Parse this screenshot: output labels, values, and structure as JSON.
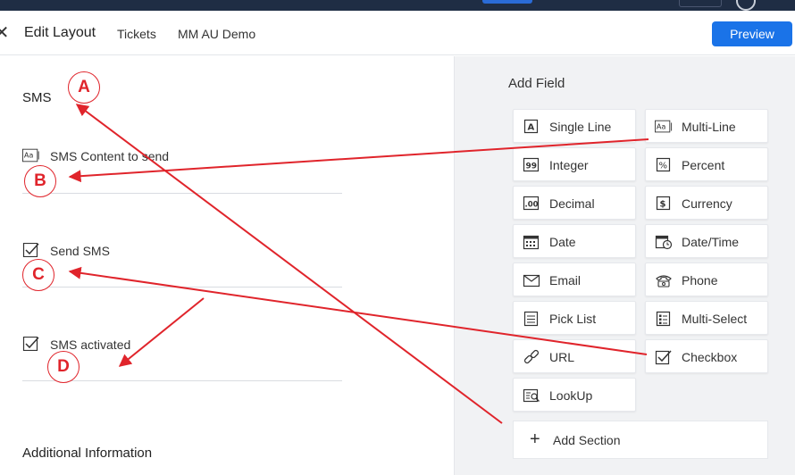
{
  "header": {
    "title": "Edit Layout",
    "breadcrumbs": [
      "Tickets",
      "MM AU Demo"
    ],
    "preview_label": "Preview"
  },
  "layout": {
    "sections": [
      {
        "title": "SMS",
        "fields": [
          {
            "label": "SMS Content to send",
            "icon": "multi-line-icon"
          },
          {
            "label": "Send SMS",
            "icon": "checkbox-icon"
          },
          {
            "label": "SMS activated",
            "icon": "checkbox-icon"
          }
        ]
      },
      {
        "title": "Additional Information",
        "fields": []
      }
    ]
  },
  "add_field": {
    "title": "Add Field",
    "tiles": [
      {
        "label": "Single Line",
        "icon": "single-line-icon"
      },
      {
        "label": "Multi-Line",
        "icon": "multi-line-icon"
      },
      {
        "label": "Integer",
        "icon": "integer-icon"
      },
      {
        "label": "Percent",
        "icon": "percent-icon"
      },
      {
        "label": "Decimal",
        "icon": "decimal-icon"
      },
      {
        "label": "Currency",
        "icon": "currency-icon"
      },
      {
        "label": "Date",
        "icon": "calendar-icon"
      },
      {
        "label": "Date/Time",
        "icon": "calendar-clock-icon"
      },
      {
        "label": "Email",
        "icon": "envelope-icon"
      },
      {
        "label": "Phone",
        "icon": "phone-icon"
      },
      {
        "label": "Pick List",
        "icon": "list-icon"
      },
      {
        "label": "Multi-Select",
        "icon": "checklist-icon"
      },
      {
        "label": "URL",
        "icon": "link-icon"
      },
      {
        "label": "Checkbox",
        "icon": "checkbox-icon"
      },
      {
        "label": "LookUp",
        "icon": "lookup-icon"
      }
    ],
    "add_section_label": "Add Section"
  },
  "annotations": {
    "markers": [
      "A",
      "B",
      "C",
      "D"
    ],
    "color": "#e0242b"
  },
  "colors": {
    "accent": "#1a73e8",
    "top_bar": "#1f2d44",
    "panel_bg": "#f1f2f4"
  }
}
